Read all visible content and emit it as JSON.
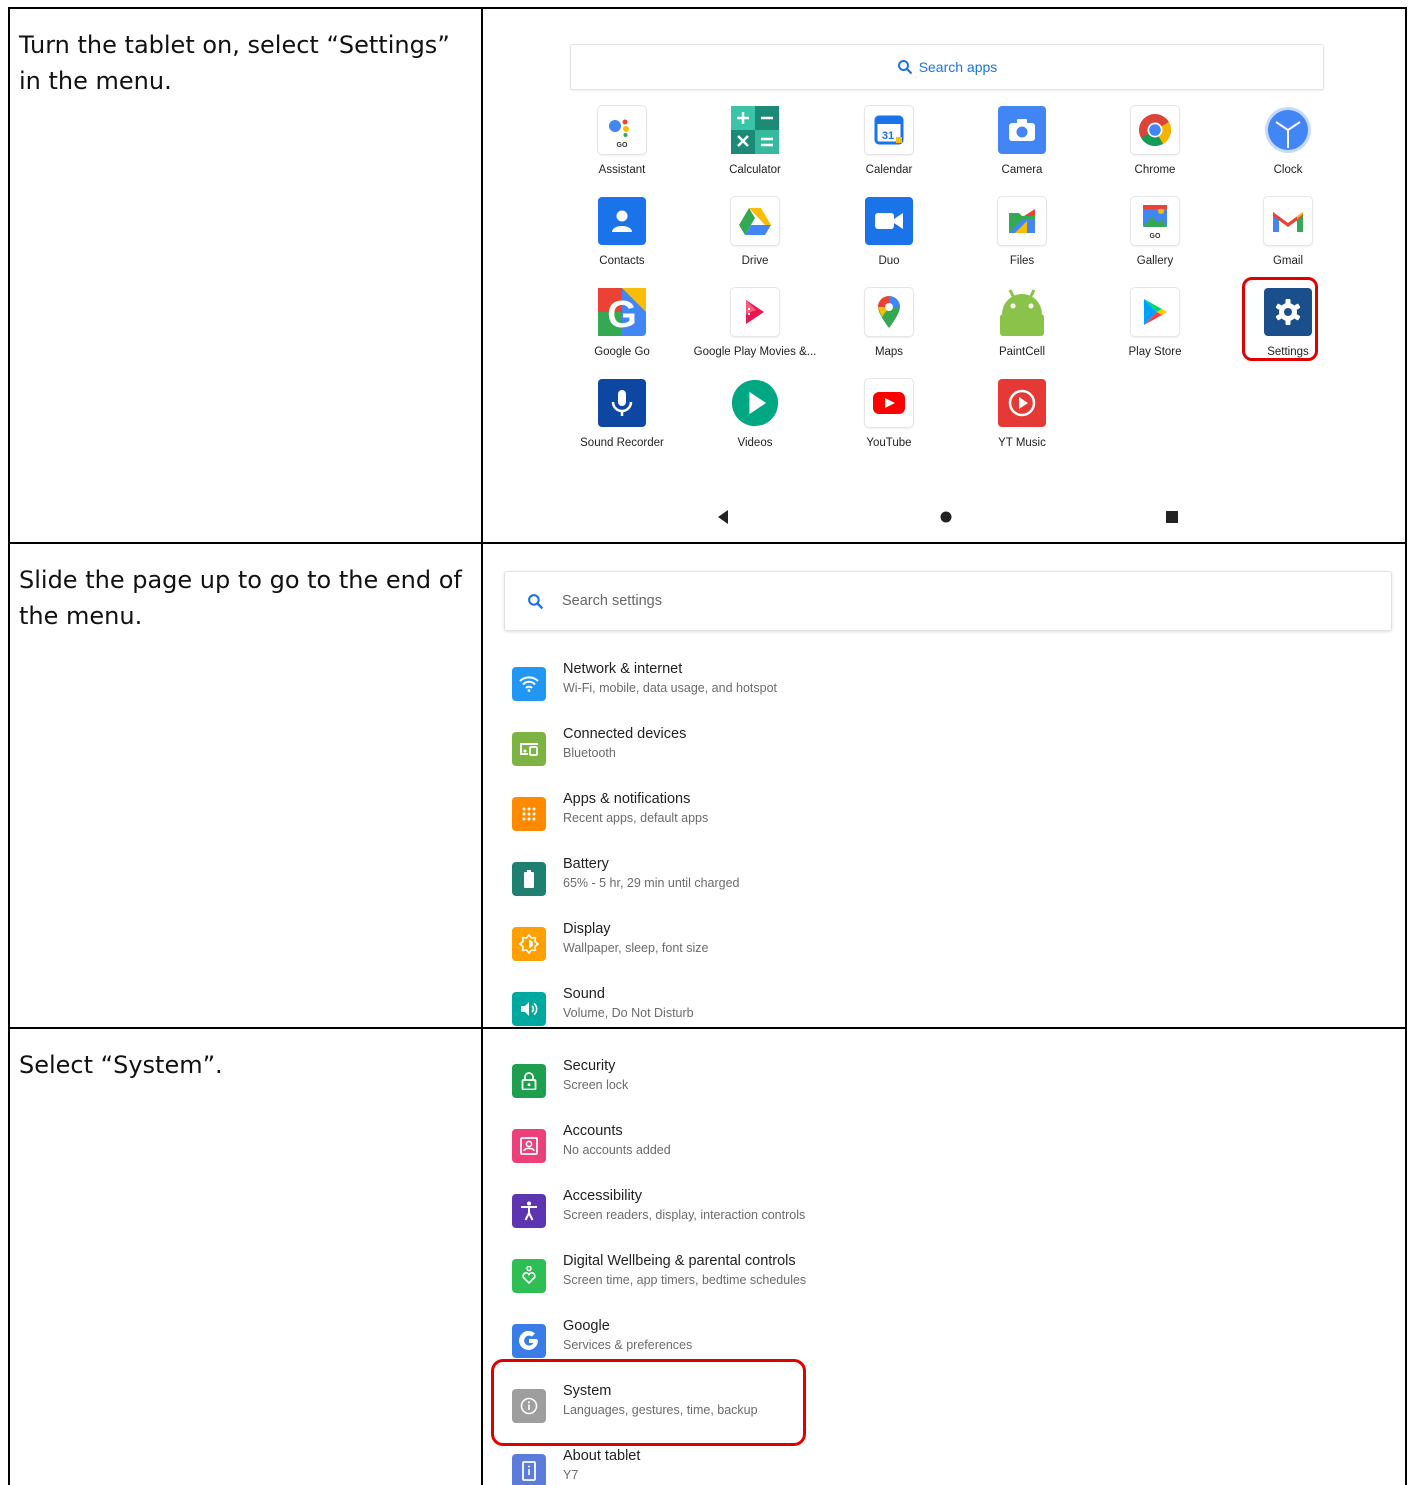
{
  "steps": [
    {
      "instruction": "Turn the tablet on, select “Settings” in the menu."
    },
    {
      "instruction": "Slide the page up to go to the end of the menu."
    },
    {
      "instruction": "Select “System”."
    }
  ],
  "launcher": {
    "search_placeholder": "Search apps",
    "apps": [
      {
        "label": "Assistant",
        "icon": "assistant-icon",
        "color": "#ffffff"
      },
      {
        "label": "Calculator",
        "icon": "calculator-icon",
        "color": "#1a9e8c"
      },
      {
        "label": "Calendar",
        "icon": "calendar-icon",
        "color": "#ffffff"
      },
      {
        "label": "Camera",
        "icon": "camera-icon",
        "color": "#4285f4"
      },
      {
        "label": "Chrome",
        "icon": "chrome-icon",
        "color": "#ffffff"
      },
      {
        "label": "Clock",
        "icon": "clock-icon",
        "color": "#4285f4"
      },
      {
        "label": "Contacts",
        "icon": "contacts-icon",
        "color": "#1a73e8"
      },
      {
        "label": "Drive",
        "icon": "drive-icon",
        "color": "#ffffff"
      },
      {
        "label": "Duo",
        "icon": "duo-icon",
        "color": "#1a73e8"
      },
      {
        "label": "Files",
        "icon": "files-icon",
        "color": "#ffffff"
      },
      {
        "label": "Gallery",
        "icon": "gallery-icon",
        "color": "#ffffff"
      },
      {
        "label": "Gmail",
        "icon": "gmail-icon",
        "color": "#ffffff"
      },
      {
        "label": "Google Go",
        "icon": "google-go-icon",
        "color": "#4285f4"
      },
      {
        "label": "Google Play Movies &...",
        "icon": "play-movies-icon",
        "color": "#ffffff"
      },
      {
        "label": "Maps",
        "icon": "maps-icon",
        "color": "#ffffff"
      },
      {
        "label": "PaintCell",
        "icon": "android-icon",
        "color": "#8bc34a"
      },
      {
        "label": "Play Store",
        "icon": "play-store-icon",
        "color": "#ffffff"
      },
      {
        "label": "Settings",
        "icon": "settings-gear-icon",
        "color": "#1a4f8c"
      },
      {
        "label": "Sound Recorder",
        "icon": "microphone-icon",
        "color": "#0d47a1"
      },
      {
        "label": "Videos",
        "icon": "video-play-icon",
        "color": "#00a783"
      },
      {
        "label": "YouTube",
        "icon": "youtube-icon",
        "color": "#ffffff"
      },
      {
        "label": "YT Music",
        "icon": "yt-music-icon",
        "color": "#e53935"
      }
    ]
  },
  "settings_top": {
    "search_placeholder": "Search settings",
    "items": [
      {
        "title": "Network & internet",
        "subtitle": "Wi-Fi, mobile, data usage, and hotspot",
        "icon": "wifi-icon",
        "color": "#2196f3"
      },
      {
        "title": "Connected devices",
        "subtitle": "Bluetooth",
        "icon": "devices-icon",
        "color": "#7cb342"
      },
      {
        "title": "Apps & notifications",
        "subtitle": "Recent apps, default apps",
        "icon": "apps-grid-icon",
        "color": "#ff8a00"
      },
      {
        "title": "Battery",
        "subtitle": "65% - 5 hr, 29 min until charged",
        "icon": "battery-icon",
        "color": "#1f8072"
      },
      {
        "title": "Display",
        "subtitle": "Wallpaper, sleep, font size",
        "icon": "brightness-icon",
        "color": "#ffa000"
      },
      {
        "title": "Sound",
        "subtitle": "Volume, Do Not Disturb",
        "icon": "volume-icon",
        "color": "#00a9a0"
      }
    ]
  },
  "settings_bottom": {
    "items": [
      {
        "title": "Security",
        "subtitle": "Screen lock",
        "icon": "lock-icon",
        "color": "#1e9e4f"
      },
      {
        "title": "Accounts",
        "subtitle": "No accounts added",
        "icon": "account-box-icon",
        "color": "#ec407a"
      },
      {
        "title": "Accessibility",
        "subtitle": "Screen readers, display, interaction controls",
        "icon": "accessibility-icon",
        "color": "#5e35b1"
      },
      {
        "title": "Digital Wellbeing & parental controls",
        "subtitle": "Screen time, app timers, bedtime schedules",
        "icon": "wellbeing-icon",
        "color": "#2fbe53"
      },
      {
        "title": "Google",
        "subtitle": "Services & preferences",
        "icon": "google-icon",
        "color": "#3b7de6"
      },
      {
        "title": "System",
        "subtitle": "Languages, gestures, time, backup",
        "icon": "info-icon",
        "color": "#9e9e9e"
      },
      {
        "title": "About tablet",
        "subtitle": "Y7",
        "icon": "tablet-icon",
        "color": "#5c7cdb"
      }
    ]
  }
}
